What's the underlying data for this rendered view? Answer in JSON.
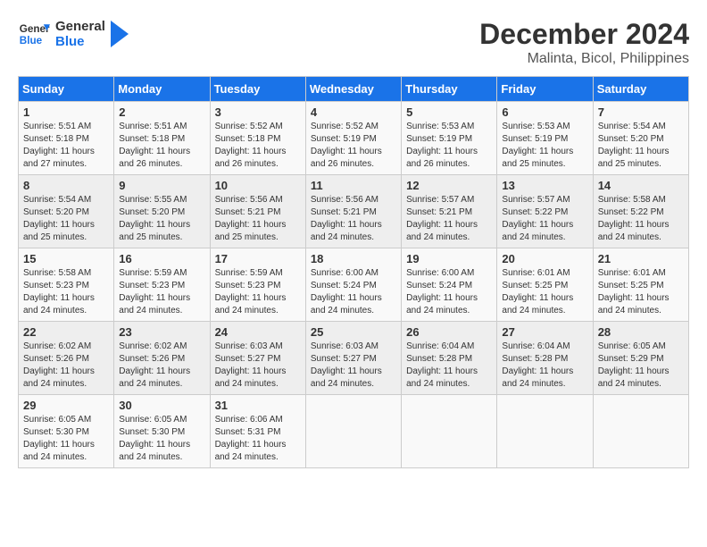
{
  "logo": {
    "line1": "General",
    "line2": "Blue"
  },
  "title": "December 2024",
  "subtitle": "Malinta, Bicol, Philippines",
  "days_of_week": [
    "Sunday",
    "Monday",
    "Tuesday",
    "Wednesday",
    "Thursday",
    "Friday",
    "Saturday"
  ],
  "weeks": [
    [
      {
        "day": "1",
        "sunrise": "5:51 AM",
        "sunset": "5:18 PM",
        "daylight": "11 hours and 27 minutes."
      },
      {
        "day": "2",
        "sunrise": "5:51 AM",
        "sunset": "5:18 PM",
        "daylight": "11 hours and 26 minutes."
      },
      {
        "day": "3",
        "sunrise": "5:52 AM",
        "sunset": "5:18 PM",
        "daylight": "11 hours and 26 minutes."
      },
      {
        "day": "4",
        "sunrise": "5:52 AM",
        "sunset": "5:19 PM",
        "daylight": "11 hours and 26 minutes."
      },
      {
        "day": "5",
        "sunrise": "5:53 AM",
        "sunset": "5:19 PM",
        "daylight": "11 hours and 26 minutes."
      },
      {
        "day": "6",
        "sunrise": "5:53 AM",
        "sunset": "5:19 PM",
        "daylight": "11 hours and 25 minutes."
      },
      {
        "day": "7",
        "sunrise": "5:54 AM",
        "sunset": "5:20 PM",
        "daylight": "11 hours and 25 minutes."
      }
    ],
    [
      {
        "day": "8",
        "sunrise": "5:54 AM",
        "sunset": "5:20 PM",
        "daylight": "11 hours and 25 minutes."
      },
      {
        "day": "9",
        "sunrise": "5:55 AM",
        "sunset": "5:20 PM",
        "daylight": "11 hours and 25 minutes."
      },
      {
        "day": "10",
        "sunrise": "5:56 AM",
        "sunset": "5:21 PM",
        "daylight": "11 hours and 25 minutes."
      },
      {
        "day": "11",
        "sunrise": "5:56 AM",
        "sunset": "5:21 PM",
        "daylight": "11 hours and 24 minutes."
      },
      {
        "day": "12",
        "sunrise": "5:57 AM",
        "sunset": "5:21 PM",
        "daylight": "11 hours and 24 minutes."
      },
      {
        "day": "13",
        "sunrise": "5:57 AM",
        "sunset": "5:22 PM",
        "daylight": "11 hours and 24 minutes."
      },
      {
        "day": "14",
        "sunrise": "5:58 AM",
        "sunset": "5:22 PM",
        "daylight": "11 hours and 24 minutes."
      }
    ],
    [
      {
        "day": "15",
        "sunrise": "5:58 AM",
        "sunset": "5:23 PM",
        "daylight": "11 hours and 24 minutes."
      },
      {
        "day": "16",
        "sunrise": "5:59 AM",
        "sunset": "5:23 PM",
        "daylight": "11 hours and 24 minutes."
      },
      {
        "day": "17",
        "sunrise": "5:59 AM",
        "sunset": "5:23 PM",
        "daylight": "11 hours and 24 minutes."
      },
      {
        "day": "18",
        "sunrise": "6:00 AM",
        "sunset": "5:24 PM",
        "daylight": "11 hours and 24 minutes."
      },
      {
        "day": "19",
        "sunrise": "6:00 AM",
        "sunset": "5:24 PM",
        "daylight": "11 hours and 24 minutes."
      },
      {
        "day": "20",
        "sunrise": "6:01 AM",
        "sunset": "5:25 PM",
        "daylight": "11 hours and 24 minutes."
      },
      {
        "day": "21",
        "sunrise": "6:01 AM",
        "sunset": "5:25 PM",
        "daylight": "11 hours and 24 minutes."
      }
    ],
    [
      {
        "day": "22",
        "sunrise": "6:02 AM",
        "sunset": "5:26 PM",
        "daylight": "11 hours and 24 minutes."
      },
      {
        "day": "23",
        "sunrise": "6:02 AM",
        "sunset": "5:26 PM",
        "daylight": "11 hours and 24 minutes."
      },
      {
        "day": "24",
        "sunrise": "6:03 AM",
        "sunset": "5:27 PM",
        "daylight": "11 hours and 24 minutes."
      },
      {
        "day": "25",
        "sunrise": "6:03 AM",
        "sunset": "5:27 PM",
        "daylight": "11 hours and 24 minutes."
      },
      {
        "day": "26",
        "sunrise": "6:04 AM",
        "sunset": "5:28 PM",
        "daylight": "11 hours and 24 minutes."
      },
      {
        "day": "27",
        "sunrise": "6:04 AM",
        "sunset": "5:28 PM",
        "daylight": "11 hours and 24 minutes."
      },
      {
        "day": "28",
        "sunrise": "6:05 AM",
        "sunset": "5:29 PM",
        "daylight": "11 hours and 24 minutes."
      }
    ],
    [
      {
        "day": "29",
        "sunrise": "6:05 AM",
        "sunset": "5:30 PM",
        "daylight": "11 hours and 24 minutes."
      },
      {
        "day": "30",
        "sunrise": "6:05 AM",
        "sunset": "5:30 PM",
        "daylight": "11 hours and 24 minutes."
      },
      {
        "day": "31",
        "sunrise": "6:06 AM",
        "sunset": "5:31 PM",
        "daylight": "11 hours and 24 minutes."
      },
      null,
      null,
      null,
      null
    ]
  ],
  "labels": {
    "sunrise": "Sunrise:",
    "sunset": "Sunset:",
    "daylight": "Daylight:"
  }
}
